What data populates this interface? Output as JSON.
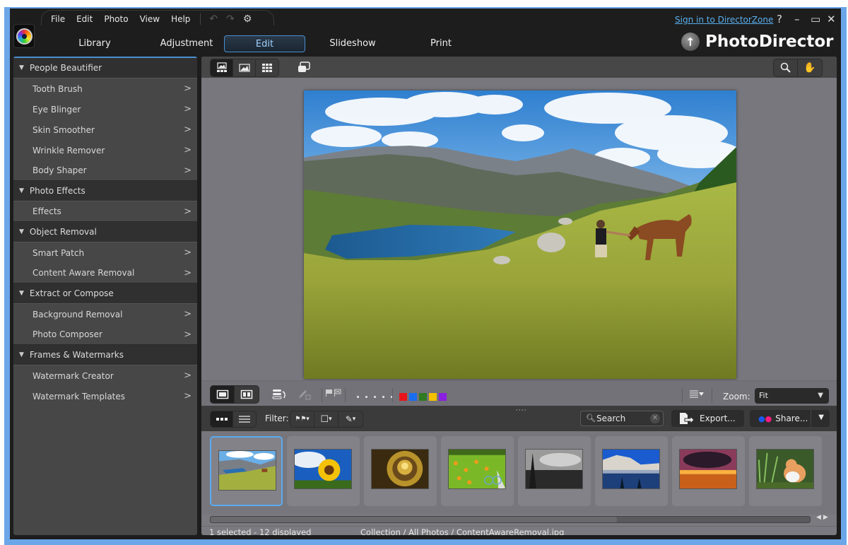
{
  "app": {
    "name": "PhotoDirector",
    "signin_link": "Sign in to DirectorZone",
    "help": "?",
    "minimize": "–",
    "maximize": "▭",
    "close": "✕"
  },
  "menu": [
    "File",
    "Edit",
    "Photo",
    "View",
    "Help"
  ],
  "toolbar_icons": {
    "undo": "↶",
    "redo": "↷",
    "settings": "⚙"
  },
  "modes": [
    {
      "label": "Library",
      "active": false
    },
    {
      "label": "Adjustment",
      "active": false
    },
    {
      "label": "Edit",
      "active": true
    },
    {
      "label": "Slideshow",
      "active": false
    },
    {
      "label": "Print",
      "active": false
    }
  ],
  "left_panel": {
    "sections": [
      {
        "title": "People Beautifier",
        "items": [
          "Tooth Brush",
          "Eye Blinger",
          "Skin Smoother",
          "Wrinkle Remover",
          "Body Shaper"
        ]
      },
      {
        "title": "Photo Effects",
        "items": [
          "Effects"
        ]
      },
      {
        "title": "Object Removal",
        "items": [
          "Smart Patch",
          "Content Aware Removal"
        ]
      },
      {
        "title": "Extract or Compose",
        "items": [
          "Background Removal",
          "Photo Composer"
        ]
      },
      {
        "title": "Frames & Watermarks",
        "items": [
          "Watermark Creator",
          "Watermark Templates"
        ]
      }
    ]
  },
  "view_toolbar": {
    "color_labels": [
      "#e8141a",
      "#1a6ef0",
      "#2f7a22",
      "#f5c000",
      "#8a1fe0"
    ],
    "rating_dots": 5,
    "zoom_label": "Zoom:",
    "zoom_value": "Fit"
  },
  "browser": {
    "filter_label": "Filter:",
    "search_placeholder": "Search",
    "export_label": "Export...",
    "share_label": "Share...",
    "grip": "····"
  },
  "thumbnails": [
    {
      "subject": "mountain-lake-horse",
      "selected": true
    },
    {
      "subject": "sunflower",
      "selected": false
    },
    {
      "subject": "spiral-staircase",
      "selected": false
    },
    {
      "subject": "bicycle-flowers",
      "selected": false
    },
    {
      "subject": "harbor-bw",
      "selected": false
    },
    {
      "subject": "snowy-mountain-lake",
      "selected": false
    },
    {
      "subject": "sunset-clouds",
      "selected": false
    },
    {
      "subject": "cat",
      "selected": false
    }
  ],
  "status": {
    "selection": "1 selected - 12 displayed",
    "path": "Collection / All Photos / ContentAwareRemoval.jpg"
  }
}
